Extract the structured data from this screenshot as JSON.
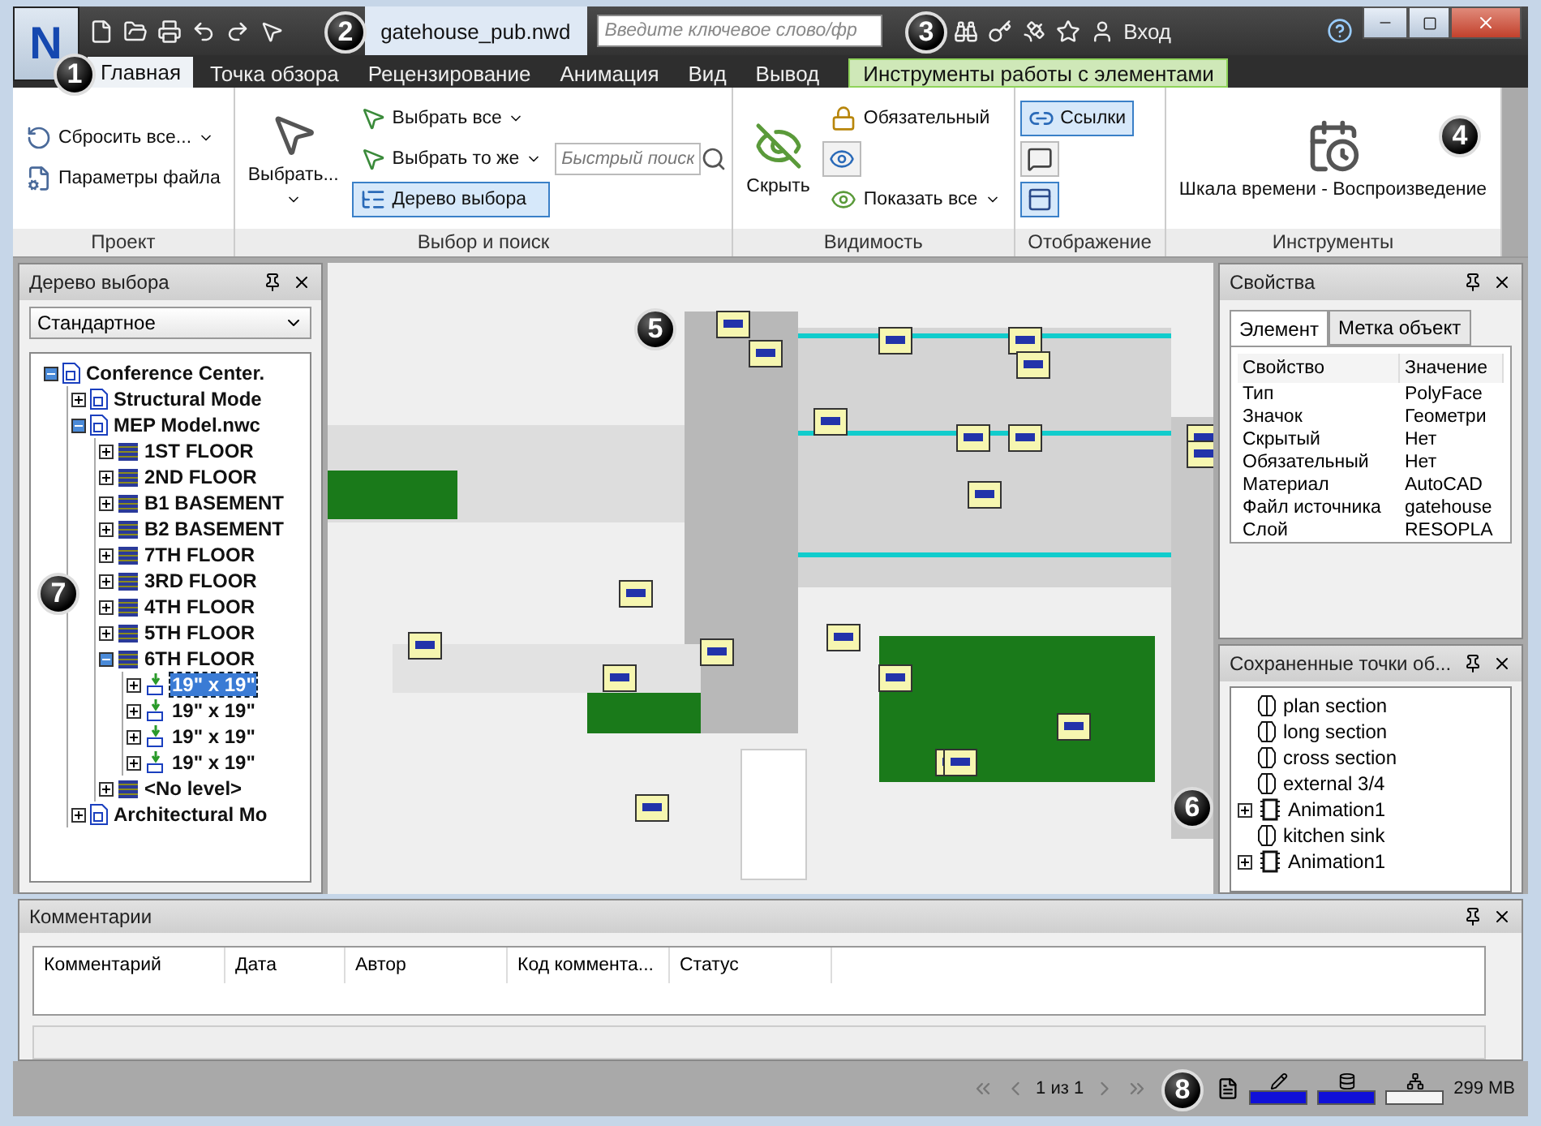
{
  "app_button": {
    "letter": "N"
  },
  "document_title": "gatehouse_pub.nwd",
  "search": {
    "placeholder": "Введите ключевое слово/фр"
  },
  "sign_in": "Вход",
  "tabs": [
    {
      "label": "Главная",
      "kind": "normal",
      "selected": true
    },
    {
      "label": "Точка обзора",
      "kind": "normal",
      "selected": false
    },
    {
      "label": "Рецензирование",
      "kind": "normal",
      "selected": false
    },
    {
      "label": "Анимация",
      "kind": "normal",
      "selected": false
    },
    {
      "label": "Вид",
      "kind": "normal",
      "selected": false
    },
    {
      "label": "Вывод",
      "kind": "normal",
      "selected": false
    },
    {
      "label": "Инструменты работы с элементами",
      "kind": "contextual",
      "selected": false
    }
  ],
  "ribbon_groups": [
    {
      "title": "Проект",
      "columns": [
        [
          {
            "kind": "small",
            "label": "Сбросить все...",
            "dropdown": true,
            "selected": false
          },
          {
            "kind": "small",
            "label": "Параметры файла",
            "dropdown": false,
            "selected": false
          }
        ]
      ]
    },
    {
      "title": "Выбор и поиск",
      "columns": [
        [
          {
            "kind": "large",
            "label": "Выбрать...",
            "dropdown": true
          }
        ],
        [
          {
            "kind": "small",
            "label": "Выбрать все",
            "dropdown": true,
            "selected": false
          },
          {
            "kind": "small",
            "label": "Выбрать то же",
            "dropdown": true,
            "selected": false
          },
          {
            "kind": "small",
            "label": "Дерево выбора",
            "dropdown": false,
            "selected": true
          }
        ],
        [
          {
            "kind": "search",
            "placeholder": "Быстрый поиск"
          }
        ]
      ]
    },
    {
      "title": "Видимость",
      "columns": [
        [
          {
            "kind": "large",
            "label": "Скрыть",
            "dropdown": false
          }
        ],
        [
          {
            "kind": "small",
            "label": "Обязательный",
            "dropdown": false,
            "selected": false
          },
          {
            "kind": "icon",
            "selected": false
          },
          {
            "kind": "small",
            "label": "Показать все",
            "dropdown": true,
            "selected": false
          }
        ]
      ]
    },
    {
      "title": "Отображение",
      "columns": [
        [
          {
            "kind": "small",
            "label": "Ссылки",
            "dropdown": false,
            "selected": true
          },
          {
            "kind": "icon",
            "selected": false
          },
          {
            "kind": "icon",
            "selected": true
          }
        ]
      ]
    },
    {
      "title": "Инструменты",
      "columns": [
        [
          {
            "kind": "large",
            "label": "Шкала времени - Воспроизведение",
            "dropdown": false
          }
        ]
      ]
    }
  ],
  "selection_tree": {
    "title": "Дерево выбора",
    "mode": "Стандартное",
    "nodes": [
      {
        "label": "Conference Center.",
        "kind": "file",
        "expanded": true,
        "selected": false,
        "children": [
          {
            "label": "Structural Mode",
            "kind": "file",
            "expanded": false,
            "selected": false
          },
          {
            "label": "MEP Model.nwc",
            "kind": "file",
            "expanded": true,
            "selected": false,
            "children": [
              {
                "label": "1ST FLOOR",
                "kind": "layer",
                "expanded": false,
                "selected": false
              },
              {
                "label": "2ND FLOOR",
                "kind": "layer",
                "expanded": false,
                "selected": false
              },
              {
                "label": "B1 BASEMENT",
                "kind": "layer",
                "expanded": false,
                "selected": false
              },
              {
                "label": "B2  BASEMENT",
                "kind": "layer",
                "expanded": false,
                "selected": false
              },
              {
                "label": "7TH FLOOR",
                "kind": "layer",
                "expanded": false,
                "selected": false
              },
              {
                "label": "3RD FLOOR",
                "kind": "layer",
                "expanded": false,
                "selected": false
              },
              {
                "label": "4TH FLOOR",
                "kind": "layer",
                "expanded": false,
                "selected": false
              },
              {
                "label": "5TH FLOOR",
                "kind": "layer",
                "expanded": false,
                "selected": false
              },
              {
                "label": "6TH FLOOR",
                "kind": "layer",
                "expanded": true,
                "selected": false,
                "children": [
                  {
                    "label": "19\" x 19\"",
                    "kind": "part",
                    "expanded": false,
                    "selected": true
                  },
                  {
                    "label": "19\" x 19\"",
                    "kind": "part",
                    "expanded": false,
                    "selected": false
                  },
                  {
                    "label": "19\" x 19\"",
                    "kind": "part",
                    "expanded": false,
                    "selected": false
                  },
                  {
                    "label": "19\" x 19\"",
                    "kind": "part",
                    "expanded": false,
                    "selected": false
                  }
                ]
              },
              {
                "label": "<No level>",
                "kind": "layer",
                "expanded": false,
                "selected": false
              }
            ]
          },
          {
            "label": "Architectural Mo",
            "kind": "file",
            "expanded": false,
            "selected": false
          }
        ]
      }
    ]
  },
  "properties": {
    "title": "Свойства",
    "tabs": [
      {
        "label": "Элемент",
        "selected": true
      },
      {
        "label": "Метка объект",
        "selected": false
      }
    ],
    "columns": [
      "Свойство",
      "Значение"
    ],
    "rows": [
      [
        "Тип",
        "PolyFace"
      ],
      [
        "Значок",
        "Геометри"
      ],
      [
        "Скрытый",
        "Нет"
      ],
      [
        "Обязательный",
        "Нет"
      ],
      [
        "Материал",
        "AutoCAD"
      ],
      [
        "Файл источника",
        "gatehouse"
      ],
      [
        "Слой",
        "RESOPLA"
      ]
    ]
  },
  "saved_viewpoints": {
    "title": "Сохраненные точки об...",
    "items": [
      {
        "label": "plan section",
        "kind": "view"
      },
      {
        "label": "long section",
        "kind": "view"
      },
      {
        "label": "cross section",
        "kind": "view"
      },
      {
        "label": "external 3/4",
        "kind": "view"
      },
      {
        "label": "Animation1",
        "kind": "animation",
        "expanded": false
      },
      {
        "label": "kitchen sink",
        "kind": "view"
      },
      {
        "label": "Animation1",
        "kind": "animation",
        "expanded": false
      }
    ]
  },
  "comments": {
    "title": "Комментарии",
    "columns": [
      "Комментарий",
      "Дата",
      "Автор",
      "Код коммента...",
      "Статус"
    ]
  },
  "status_bar": {
    "page": "1 из 1",
    "meters": [
      {
        "kind": "pencil",
        "on": true
      },
      {
        "kind": "disk",
        "on": true
      },
      {
        "kind": "network",
        "on": false
      }
    ],
    "memory": "299 MB"
  },
  "callouts": [
    "1",
    "2",
    "3",
    "4",
    "5",
    "6",
    "7",
    "8"
  ]
}
